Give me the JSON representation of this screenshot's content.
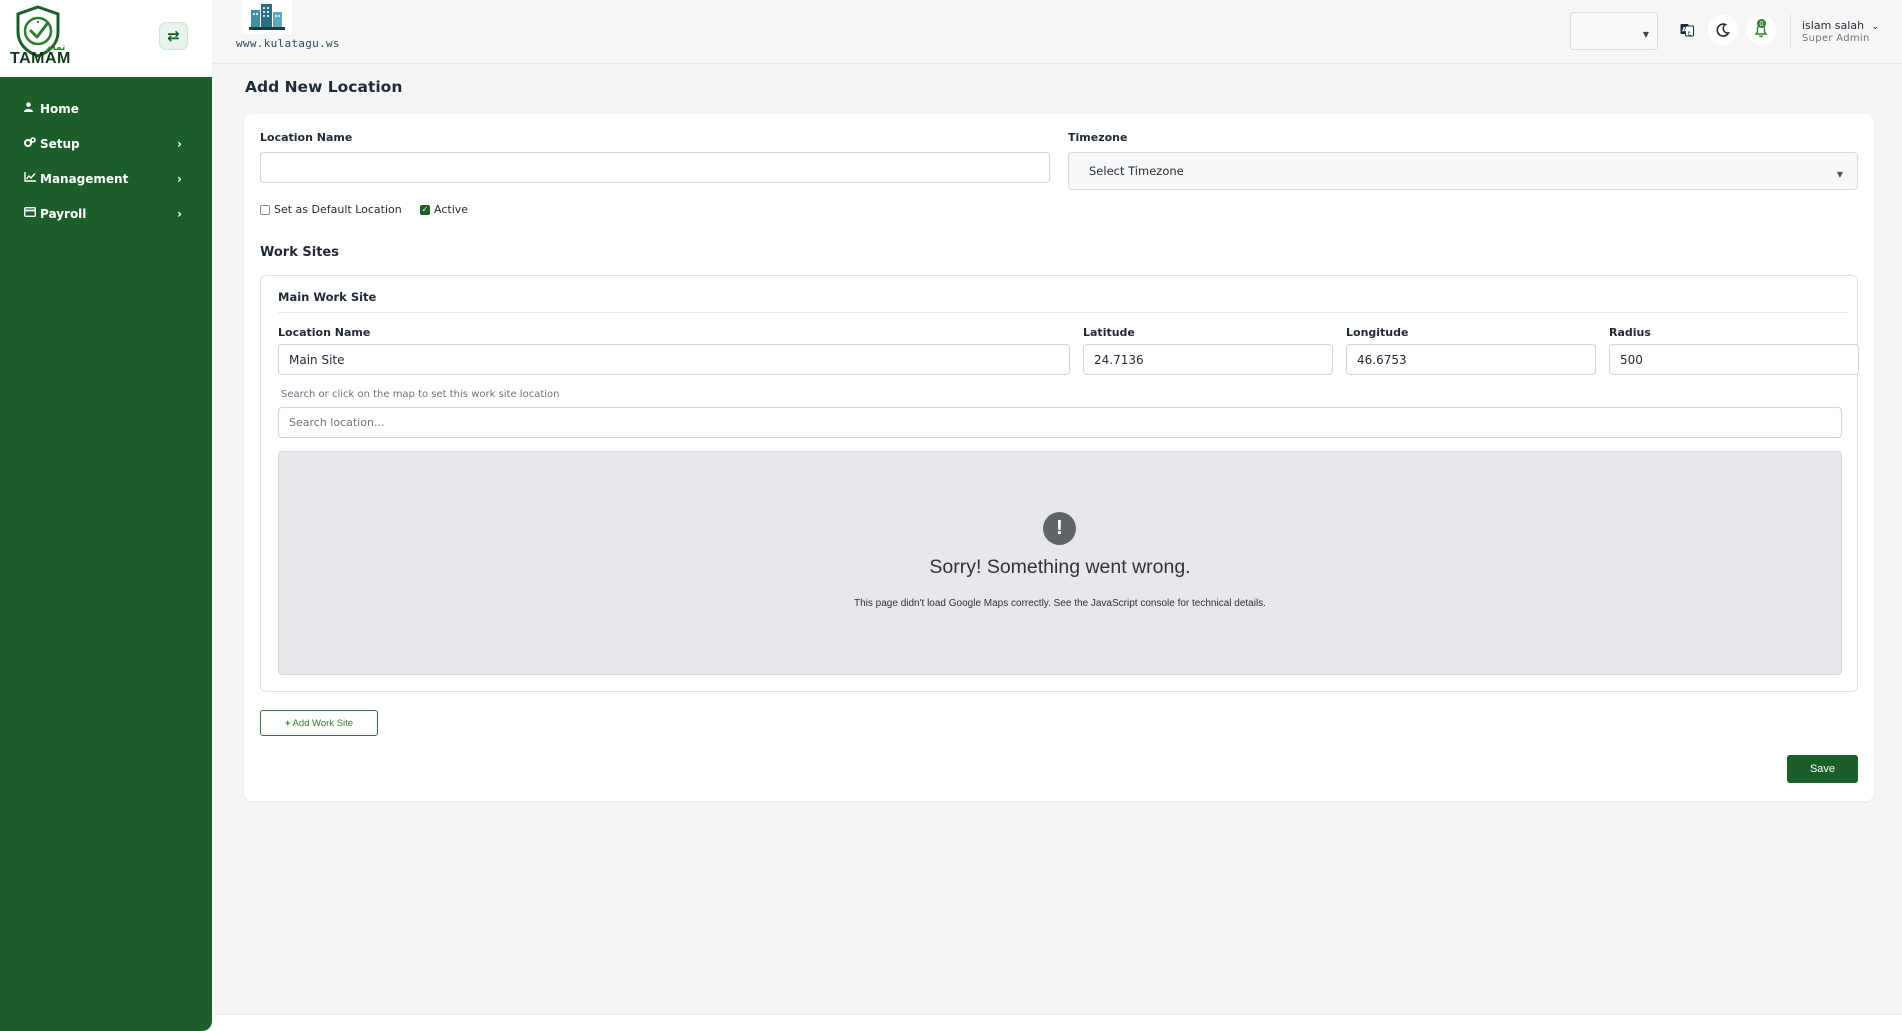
{
  "brand": {
    "logo_text": "TAMAM",
    "logo_arabic": "تمام",
    "accent_color": "#1b5e2a"
  },
  "sidebar": {
    "toggle_icon": "swap-arrows-icon",
    "items": [
      {
        "label": "Home",
        "icon": "user-icon",
        "has_children": false
      },
      {
        "label": "Setup",
        "icon": "gears-icon",
        "has_children": true
      },
      {
        "label": "Management",
        "icon": "line-chart-icon",
        "has_children": true
      },
      {
        "label": "Payroll",
        "icon": "credit-card-icon",
        "has_children": true
      }
    ]
  },
  "header": {
    "company_url": "www.kulatagu.ws",
    "language_value": "",
    "notifications_count": "0",
    "user_name": "islam salah",
    "user_role": "Super Admin"
  },
  "page": {
    "title": "Add New Location"
  },
  "form": {
    "location_name_label": "Location Name",
    "location_name_value": "",
    "timezone_label": "Timezone",
    "timezone_value": "Select Timezone",
    "default_location_label": "Set as Default Location",
    "default_location_checked": false,
    "active_label": "Active",
    "active_checked": true
  },
  "work_sites": {
    "section_title": "Work Sites",
    "sites": [
      {
        "title": "Main Work Site",
        "name_label": "Location Name",
        "name_value": "Main Site",
        "lat_label": "Latitude",
        "lat_value": "24.7136",
        "lng_label": "Longitude",
        "lng_value": "46.6753",
        "radius_label": "Radius",
        "radius_value": "500",
        "search_hint": "Search or click on the map to set this work site location",
        "search_placeholder": "Search location..."
      }
    ],
    "map_error": {
      "title": "Sorry! Something went wrong.",
      "message": "This page didn't load Google Maps correctly. See the JavaScript console for technical details."
    },
    "add_button_label": "Add Work Site"
  },
  "actions": {
    "save_label": "Save"
  }
}
